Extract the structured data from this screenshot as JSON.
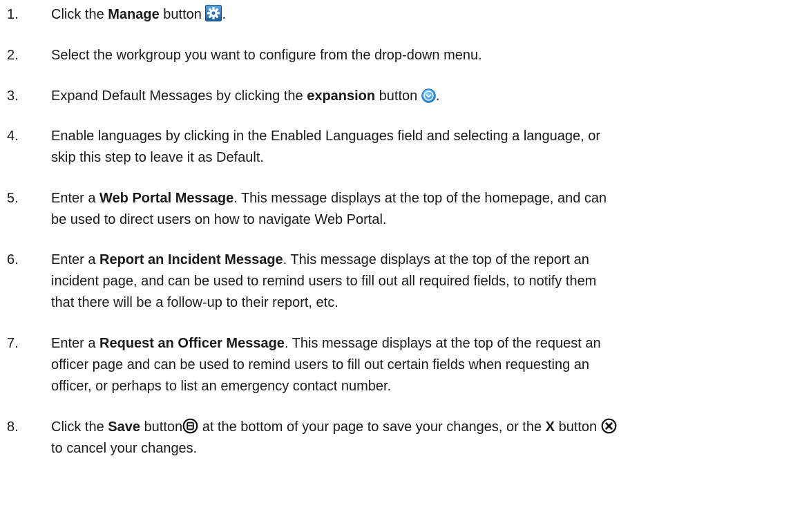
{
  "steps": [
    {
      "number": "1.",
      "segments": [
        {
          "t": "Click the "
        },
        {
          "t": "Manage",
          "b": true
        },
        {
          "t": " button "
        },
        {
          "icon": "manage-gear-icon"
        },
        {
          "t": "."
        }
      ]
    },
    {
      "number": "2.",
      "segments": [
        {
          "t": "Select the workgroup you want to configure from the drop-down menu."
        }
      ]
    },
    {
      "number": "3.",
      "segments": [
        {
          "t": "Expand Default Messages by clicking the "
        },
        {
          "t": "expansion",
          "b": true
        },
        {
          "t": " button "
        },
        {
          "icon": "expansion-chevron-icon"
        },
        {
          "t": "."
        }
      ]
    },
    {
      "number": "4.",
      "segments": [
        {
          "t": "Enable languages by clicking in the Enabled Languages field and selecting a language, or"
        },
        {
          "br": true
        },
        {
          "t": "skip this step to leave it as Default."
        }
      ]
    },
    {
      "number": "5.",
      "segments": [
        {
          "t": "Enter a "
        },
        {
          "t": "Web Portal Message",
          "b": true
        },
        {
          "t": ". This message displays at the top of the homepage, and can"
        },
        {
          "br": true
        },
        {
          "t": "be used to direct users on how to navigate Web Portal."
        }
      ]
    },
    {
      "number": "6.",
      "segments": [
        {
          "t": "Enter a "
        },
        {
          "t": "Report an Incident Message",
          "b": true
        },
        {
          "t": ". This message displays at the top of the report an"
        },
        {
          "br": true
        },
        {
          "t": "incident page, and can be used to remind users to fill out all required fields, to notify them"
        },
        {
          "br": true
        },
        {
          "t": "that there will be a follow-up to their report, etc."
        }
      ]
    },
    {
      "number": "7.",
      "segments": [
        {
          "t": "Enter a "
        },
        {
          "t": "Request an Officer Message",
          "b": true
        },
        {
          "t": ". This message displays at the top of the request an"
        },
        {
          "br": true
        },
        {
          "t": "officer page and can be used to remind users to fill out certain fields when requesting an"
        },
        {
          "br": true
        },
        {
          "t": "officer, or perhaps to list an emergency contact number."
        }
      ]
    },
    {
      "number": "8.",
      "segments": [
        {
          "t": "Click the "
        },
        {
          "t": "Save",
          "b": true
        },
        {
          "t": " button"
        },
        {
          "icon": "save-circle-icon"
        },
        {
          "t": " at the bottom of your page to save your changes, or the "
        },
        {
          "t": "X",
          "b": true
        },
        {
          "t": " button "
        },
        {
          "icon": "cancel-x-circle-icon"
        },
        {
          "br": true
        },
        {
          "t": "to cancel your changes."
        }
      ]
    }
  ]
}
